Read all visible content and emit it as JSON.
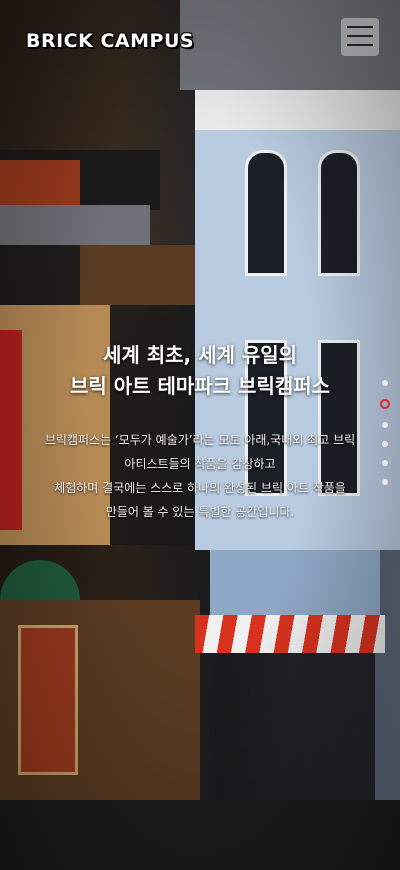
{
  "header": {
    "logo_text": "BRICK CAMPUS",
    "menu_icon": "hamburger-menu-icon"
  },
  "hero": {
    "headline_line1": "세계 최초, 세계 유일의",
    "headline_line2": "브릭 아트 테마파크 브릭캠퍼스",
    "desc_line1": "브릭캠퍼스는 ‘모두가 예술가’라는 모토 아래,국내외 최고 브릭",
    "desc_line2": "아티스트들의 작품을 감상하고",
    "desc_line3": "체험하며 결국에는 스스로 하나의 완성된 브릭 아트 작품을",
    "desc_line4": "만들어 볼 수 있는 특별한 공간입니다."
  },
  "pagination": {
    "total": 6,
    "active_index": 1,
    "active_color": "#e0262b"
  },
  "colors": {
    "headline": "#ffffff",
    "logo": "#ffffff"
  }
}
